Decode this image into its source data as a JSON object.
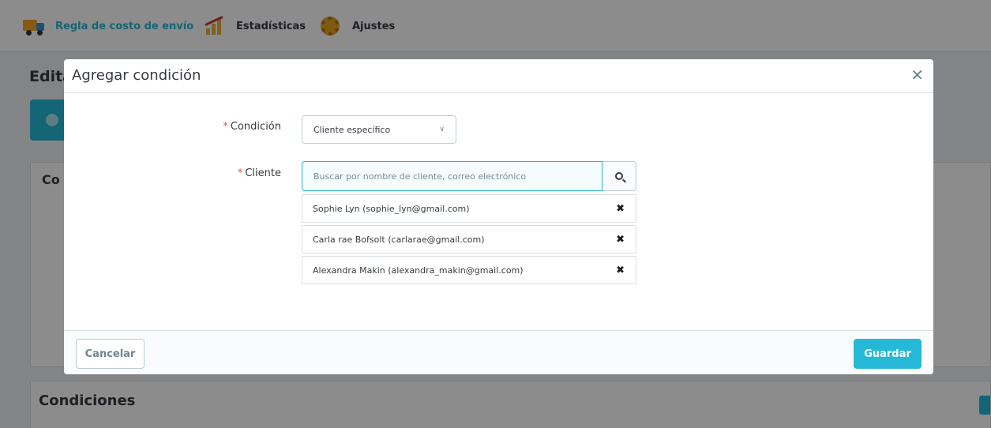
{
  "nav": {
    "items": [
      {
        "label": "Regla de costo de envío",
        "icon": "truck-icon",
        "active": true
      },
      {
        "label": "Estadísticas",
        "icon": "chart-icon",
        "active": false
      },
      {
        "label": "Ajustes",
        "icon": "gear-icon",
        "active": false
      }
    ]
  },
  "background": {
    "page_title": "Edita",
    "panel_title": "Co",
    "conditions_title": "Condiciones"
  },
  "modal": {
    "title": "Agregar condición",
    "close_icon": "✕",
    "condition": {
      "required_mark": "*",
      "label": "Condición",
      "selected": "Cliente específico"
    },
    "customer": {
      "required_mark": "*",
      "label": "Cliente",
      "search_placeholder": "Buscar por nombre de cliente, correo electrónico",
      "selected": [
        "Sophie Lyn (sophie_lyn@gmail.com)",
        "Carla rae Bofsolt (carlarae@gmail.com)",
        "Alexandra Makin (alexandra_makin@gmail.com)"
      ],
      "remove_glyph": "✖"
    },
    "footer": {
      "cancel_label": "Cancelar",
      "save_label": "Guardar"
    }
  },
  "colors": {
    "accent": "#25b9d7",
    "required": "#f54c3e"
  }
}
